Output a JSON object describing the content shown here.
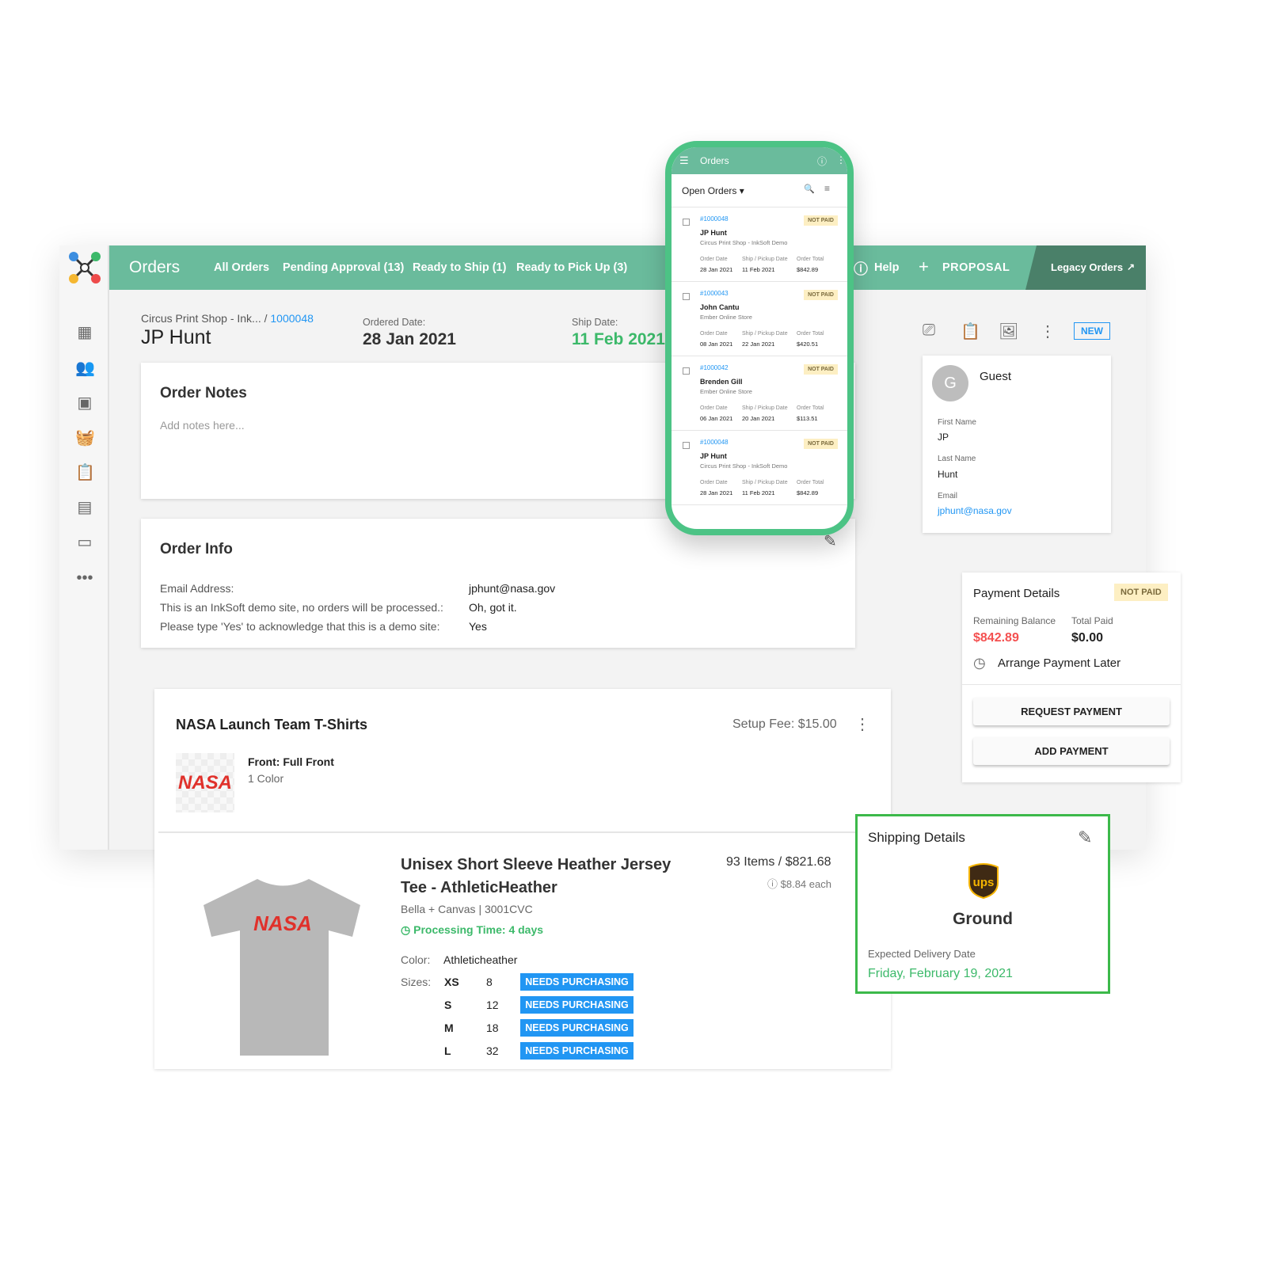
{
  "header": {
    "title": "Orders",
    "tabs": [
      "All Orders",
      "Pending Approval (13)",
      "Ready to Ship (1)",
      "Ready to Pick Up (3)"
    ],
    "help": "Help",
    "proposal": "PROPOSAL",
    "legacy": "Legacy Orders"
  },
  "sidebar": {
    "items": [
      "dashboard-icon",
      "customers-icon",
      "inbox-icon",
      "basket-icon",
      "clipboard-icon",
      "catalog-icon",
      "store-icon",
      "more-icon"
    ]
  },
  "order": {
    "breadcrumb_parent": "Circus Print Shop - Ink...",
    "breadcrumb_sep": "/",
    "order_number": "1000048",
    "customer": "JP Hunt",
    "ordered_label": "Ordered Date:",
    "ordered_date": "28 Jan 2021",
    "ship_label": "Ship Date:",
    "ship_date": "11 Feb 2021",
    "status": "NEW"
  },
  "notes": {
    "title": "Order Notes",
    "placeholder": "Add notes here..."
  },
  "info": {
    "title": "Order Info",
    "rows": [
      {
        "label": "Email Address:",
        "value": "jphunt@nasa.gov"
      },
      {
        "label": "This is an InkSoft demo site, no orders will be processed.:",
        "value": "Oh, got it."
      },
      {
        "label": "Please type 'Yes' to acknowledge that this is a demo site:",
        "value": "Yes"
      }
    ]
  },
  "phone": {
    "title": "Orders",
    "filter": "Open Orders",
    "col_labels": [
      "Order Date",
      "Ship / Pickup Date",
      "Order Total"
    ],
    "orders": [
      {
        "id": "#1000048",
        "status": "NOT PAID",
        "name": "JP Hunt",
        "store": "Circus Print Shop - InkSoft Demo",
        "order_date": "28 Jan 2021",
        "ship_date": "11 Feb 2021",
        "total": "$842.89"
      },
      {
        "id": "#1000043",
        "status": "NOT PAID",
        "name": "John Cantu",
        "store": "Ember Online Store",
        "order_date": "08 Jan 2021",
        "ship_date": "22 Jan 2021",
        "total": "$420.51"
      },
      {
        "id": "#1000042",
        "status": "NOT PAID",
        "name": "Brenden Gill",
        "store": "Ember Online Store",
        "order_date": "06 Jan 2021",
        "ship_date": "20 Jan 2021",
        "total": "$113.51"
      },
      {
        "id": "#1000048",
        "status": "NOT PAID",
        "name": "JP Hunt",
        "store": "Circus Print Shop - InkSoft Demo",
        "order_date": "28 Jan 2021",
        "ship_date": "11 Feb 2021",
        "total": "$842.89"
      }
    ]
  },
  "guest": {
    "initial": "G",
    "title": "Guest",
    "first_label": "First Name",
    "first": "JP",
    "last_label": "Last Name",
    "last": "Hunt",
    "email_label": "Email",
    "email": "jphunt@nasa.gov"
  },
  "payment": {
    "title": "Payment Details",
    "status": "NOT PAID",
    "remaining_label": "Remaining Balance",
    "remaining": "$842.89",
    "paid_label": "Total Paid",
    "paid": "$0.00",
    "arrange": "Arrange Payment Later",
    "request": "REQUEST PAYMENT",
    "add": "ADD PAYMENT"
  },
  "product": {
    "title": "NASA Launch Team T-Shirts",
    "setup_fee": "Setup Fee: $15.00",
    "logo": "NASA",
    "decoration": "Front: Full Front",
    "colors": "1 Color",
    "name_line1": "Unisex Short Sleeve Heather Jersey",
    "name_line2": "Tee - AthleticHeather",
    "brand": "Bella + Canvas | 3001CVC",
    "processing": "Processing Time: 4 days",
    "items_total": "93 Items / $821.68",
    "each": "$8.84 each",
    "color_label": "Color:",
    "color": "Athleticheather",
    "sizes_label": "Sizes:",
    "sizes": [
      {
        "size": "XS",
        "qty": "8",
        "status": "NEEDS PURCHASING"
      },
      {
        "size": "S",
        "qty": "12",
        "status": "NEEDS PURCHASING"
      },
      {
        "size": "M",
        "qty": "18",
        "status": "NEEDS PURCHASING"
      },
      {
        "size": "L",
        "qty": "32",
        "status": "NEEDS PURCHASING"
      }
    ]
  },
  "shipping": {
    "title": "Shipping Details",
    "carrier": "ups",
    "method": "Ground",
    "expected_label": "Expected Delivery Date",
    "expected": "Friday, February 19, 2021"
  },
  "colors": {
    "brand_green": "#6abb9c",
    "dark_green": "#4a8069",
    "link": "#2196f3",
    "alert": "#f44336",
    "success": "#3cb96a"
  }
}
